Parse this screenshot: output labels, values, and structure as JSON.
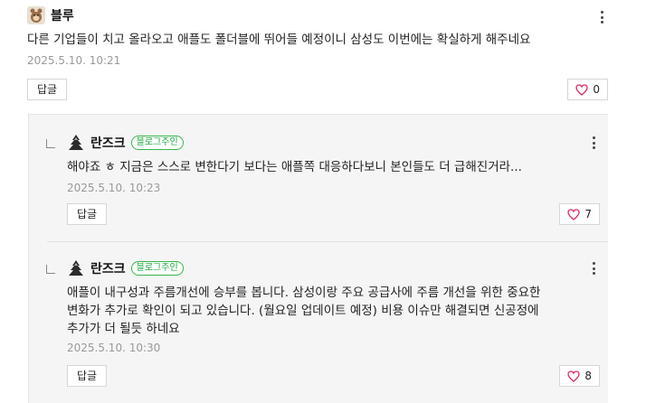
{
  "main_comment": {
    "author": "블루",
    "text": "다른 기업들이 치고 올라오고 애플도 폴더블에 뛰어들 예정이니 삼성도 이번에는 확실하게 해주네요",
    "date": "2025.5.10. 10:21",
    "reply_label": "답글",
    "likes": "0"
  },
  "replies": [
    {
      "author": "란즈크",
      "badge": "블로그주인",
      "text": "해야죠 ㅎ 지금은 스스로 변한다기 보다는 애플쪽 대응하다보니 본인들도 더 급해진거라...",
      "date": "2025.5.10. 10:23",
      "reply_label": "답글",
      "likes": "7"
    },
    {
      "author": "란즈크",
      "badge": "블로그주인",
      "text": "애플이 내구성과 주름개선에 승부를 봅니다. 삼성이랑 주요 공급사에 주름 개선을 위한 중요한\n변화가 추가로 확인이 되고 있습니다. (월요일 업데이트 예정) 비용 이슈만 해결되면 신공정에\n추가가 더 될듯 하네요",
      "date": "2025.5.10. 10:30",
      "reply_label": "답글",
      "likes": "8"
    }
  ],
  "colors": {
    "like_heart": "#e0245e",
    "badge_green": "#1aa93b",
    "reply_bg": "#f5f5f5"
  },
  "icons": {
    "main_avatar": "animal-avatar",
    "reply_avatar": "tree-avatar",
    "more": "kebab-menu-icon",
    "like": "heart-icon",
    "reply_arrow": "reply-arrow-icon"
  }
}
